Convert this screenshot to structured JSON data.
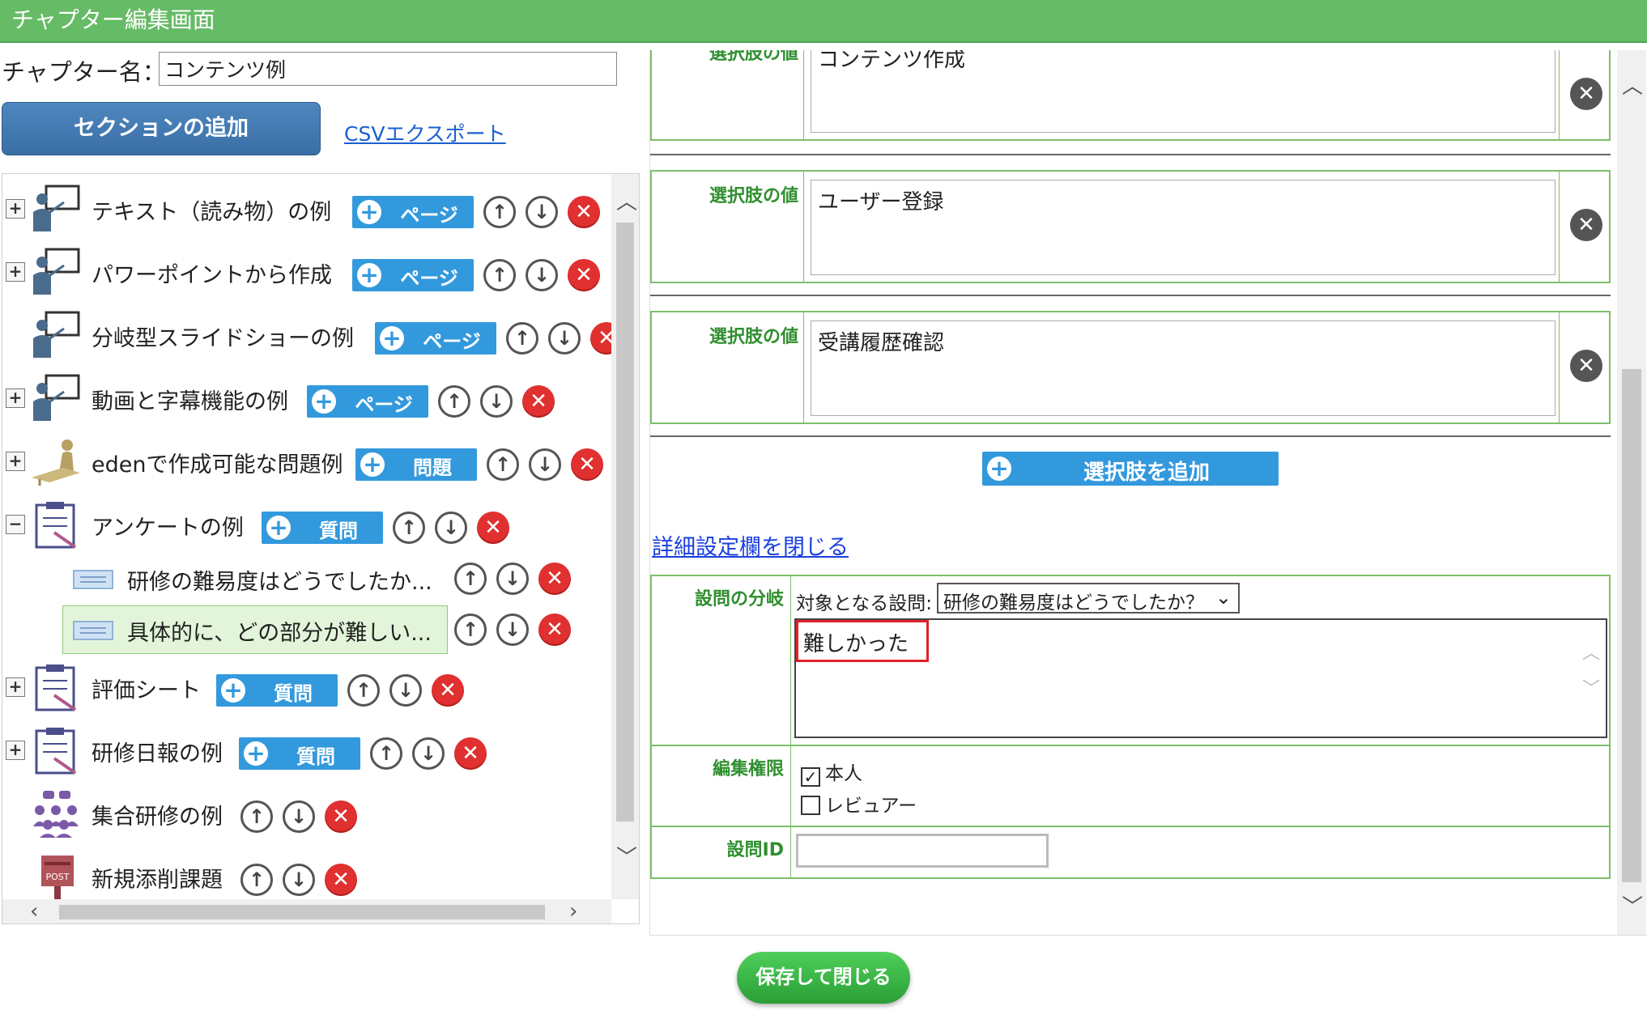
{
  "window": {
    "title": "チャプター編集画面"
  },
  "chapter": {
    "label": "チャプター名：",
    "name_value": "コンテンツ例"
  },
  "toolbar": {
    "add_section_label": "セクションの追加",
    "csv_export_label": "CSVエクスポート"
  },
  "tree": {
    "items": [
      {
        "label": "テキスト（読み物）の例",
        "type": "ページ",
        "icon": "teacher-board-icon",
        "expander": "+"
      },
      {
        "label": "パワーポイントから作成",
        "type": "ページ",
        "icon": "teacher-board-icon",
        "expander": "+"
      },
      {
        "label": "分岐型スライドショーの例",
        "type": "ページ",
        "icon": "teacher-board-icon",
        "expander": ""
      },
      {
        "label": "動画と字幕機能の例",
        "type": "ページ",
        "icon": "teacher-board-icon",
        "expander": "+"
      },
      {
        "label": "edenで作成可能な問題例",
        "type": "問題",
        "icon": "student-desk-icon",
        "expander": "+"
      },
      {
        "label": "アンケートの例",
        "type": "質問",
        "icon": "clipboard-icon",
        "expander": "−"
      },
      {
        "label": "評価シート",
        "type": "質問",
        "icon": "clipboard-icon",
        "expander": "+"
      },
      {
        "label": "研修日報の例",
        "type": "質問",
        "icon": "clipboard-icon",
        "expander": "+"
      },
      {
        "label": "集合研修の例",
        "type": "",
        "icon": "group-training-icon",
        "expander": ""
      },
      {
        "label": "新規添削課題",
        "type": "",
        "icon": "post-box-icon",
        "expander": ""
      }
    ],
    "sub_items": [
      {
        "label": "研修の難易度はどうでしたか...",
        "selected": false
      },
      {
        "label": "具体的に、どの部分が難しい...",
        "selected": true
      }
    ],
    "post_icon_text": "POST"
  },
  "choices": {
    "label": "選択肢の値",
    "partial_top": "コンテンツ作成",
    "items": [
      "ユーザー登録",
      "受講履歴確認"
    ],
    "add_label": "選択肢を追加"
  },
  "details": {
    "close_link": "詳細設定欄を閉じる",
    "branch_label": "設問の分岐",
    "target_label": "対象となる設問:",
    "target_value": "研修の難易度はどうでしたか？",
    "branch_value": "難しかった",
    "edit_label": "編集権限",
    "perm_self": "本人",
    "perm_self_checked": true,
    "perm_reviewer": "レビュアー",
    "perm_reviewer_checked": false,
    "qid_label": "設問ID",
    "qid_value": ""
  },
  "footer": {
    "save_label": "保存して閉じる"
  },
  "colors": {
    "header_green": "#66bb66",
    "badge_blue": "#3399dd",
    "delete_red": "#e03030",
    "save_green": "#2a9e35"
  }
}
